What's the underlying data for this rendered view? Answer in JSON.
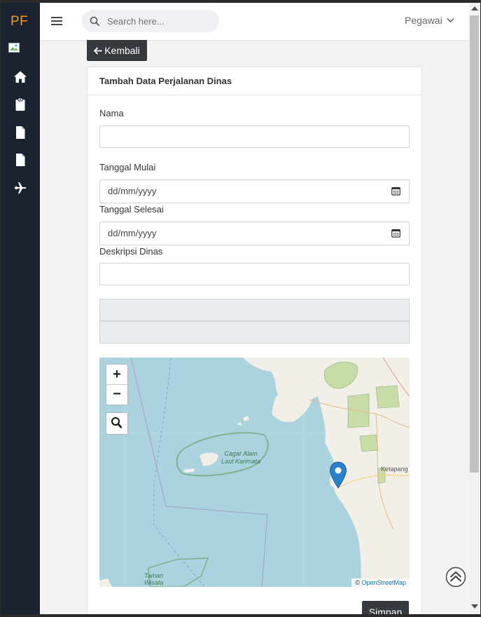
{
  "brand": {
    "logo_text": "PF"
  },
  "sidebar": {
    "items": [
      {
        "icon": "home-icon"
      },
      {
        "icon": "clipboard-icon"
      },
      {
        "icon": "file-icon"
      },
      {
        "icon": "file-icon"
      },
      {
        "icon": "plane-icon"
      }
    ]
  },
  "header": {
    "search_placeholder": "Search here...",
    "user_menu_label": "Pegawai"
  },
  "back_button": {
    "label": "Kembali"
  },
  "form": {
    "title": "Tambah Data Perjalanan Dinas",
    "fields": {
      "nama_label": "Nama",
      "nama_value": "",
      "tanggal_mulai_label": "Tanggal Mulai",
      "tanggal_mulai_placeholder": "dd/mm/yyyy",
      "tanggal_selesai_label": "Tanggal Selesai",
      "tanggal_selesai_placeholder": "dd/mm/yyyy",
      "deskripsi_label": "Deskripsi Dinas",
      "deskripsi_value": "",
      "latitude_value": "",
      "longitude_value": ""
    },
    "save_label": "Simpan"
  },
  "map": {
    "zoom_in": "+",
    "zoom_out": "−",
    "labels": {
      "reserve_line1": "Cagar Alam",
      "reserve_line2": "Laut Karimata",
      "town": "Ketapang",
      "park_line1": "Taman",
      "park_line2": "Wisata"
    },
    "attribution_prefix": "©",
    "attribution_link": "OpenStreetMap",
    "colors": {
      "water": "#aad3df",
      "land": "#f2efe9",
      "park": "#c8dca8",
      "marker": "#2a81cb"
    }
  }
}
